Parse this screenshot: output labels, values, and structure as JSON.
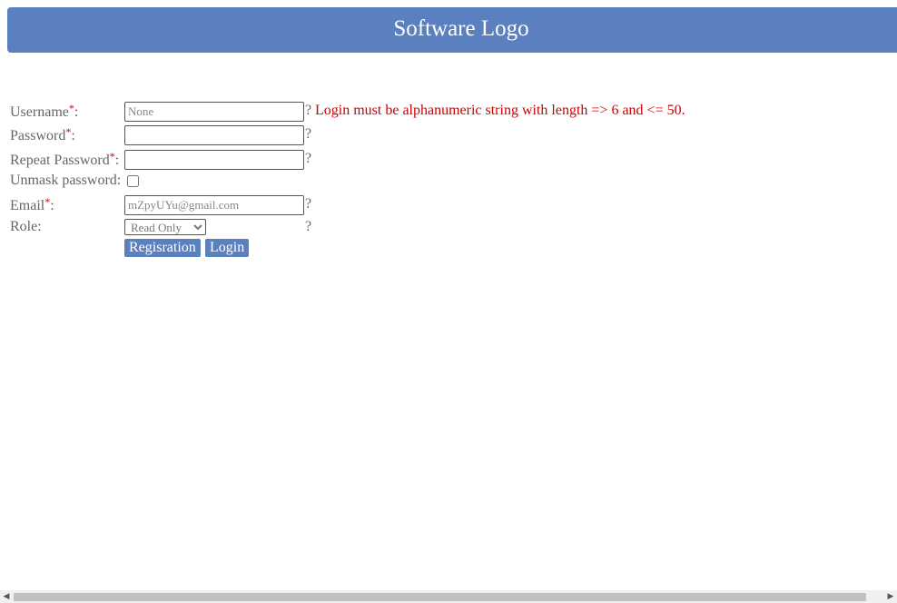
{
  "header": {
    "title": "Software Logo"
  },
  "form": {
    "required_mark": "*",
    "username": {
      "label": "Username",
      "placeholder": "None",
      "help": "?",
      "error": "Login must be alphanumeric string with length => 6 and <= 50."
    },
    "password": {
      "label": "Password",
      "help": "?"
    },
    "repeat_password": {
      "label": "Repeat Password",
      "help": "?"
    },
    "unmask": {
      "label": "Unmask password:",
      "checked": false
    },
    "email": {
      "label": "Email",
      "placeholder": "mZpyUYu@gmail.com",
      "help": "?"
    },
    "role": {
      "label": "Role:",
      "selected": "Read Only",
      "help": "?"
    },
    "buttons": {
      "registration": "Regisration",
      "login": "Login"
    }
  },
  "colors": {
    "accent": "#5b80c0",
    "error": "#cc0000"
  }
}
